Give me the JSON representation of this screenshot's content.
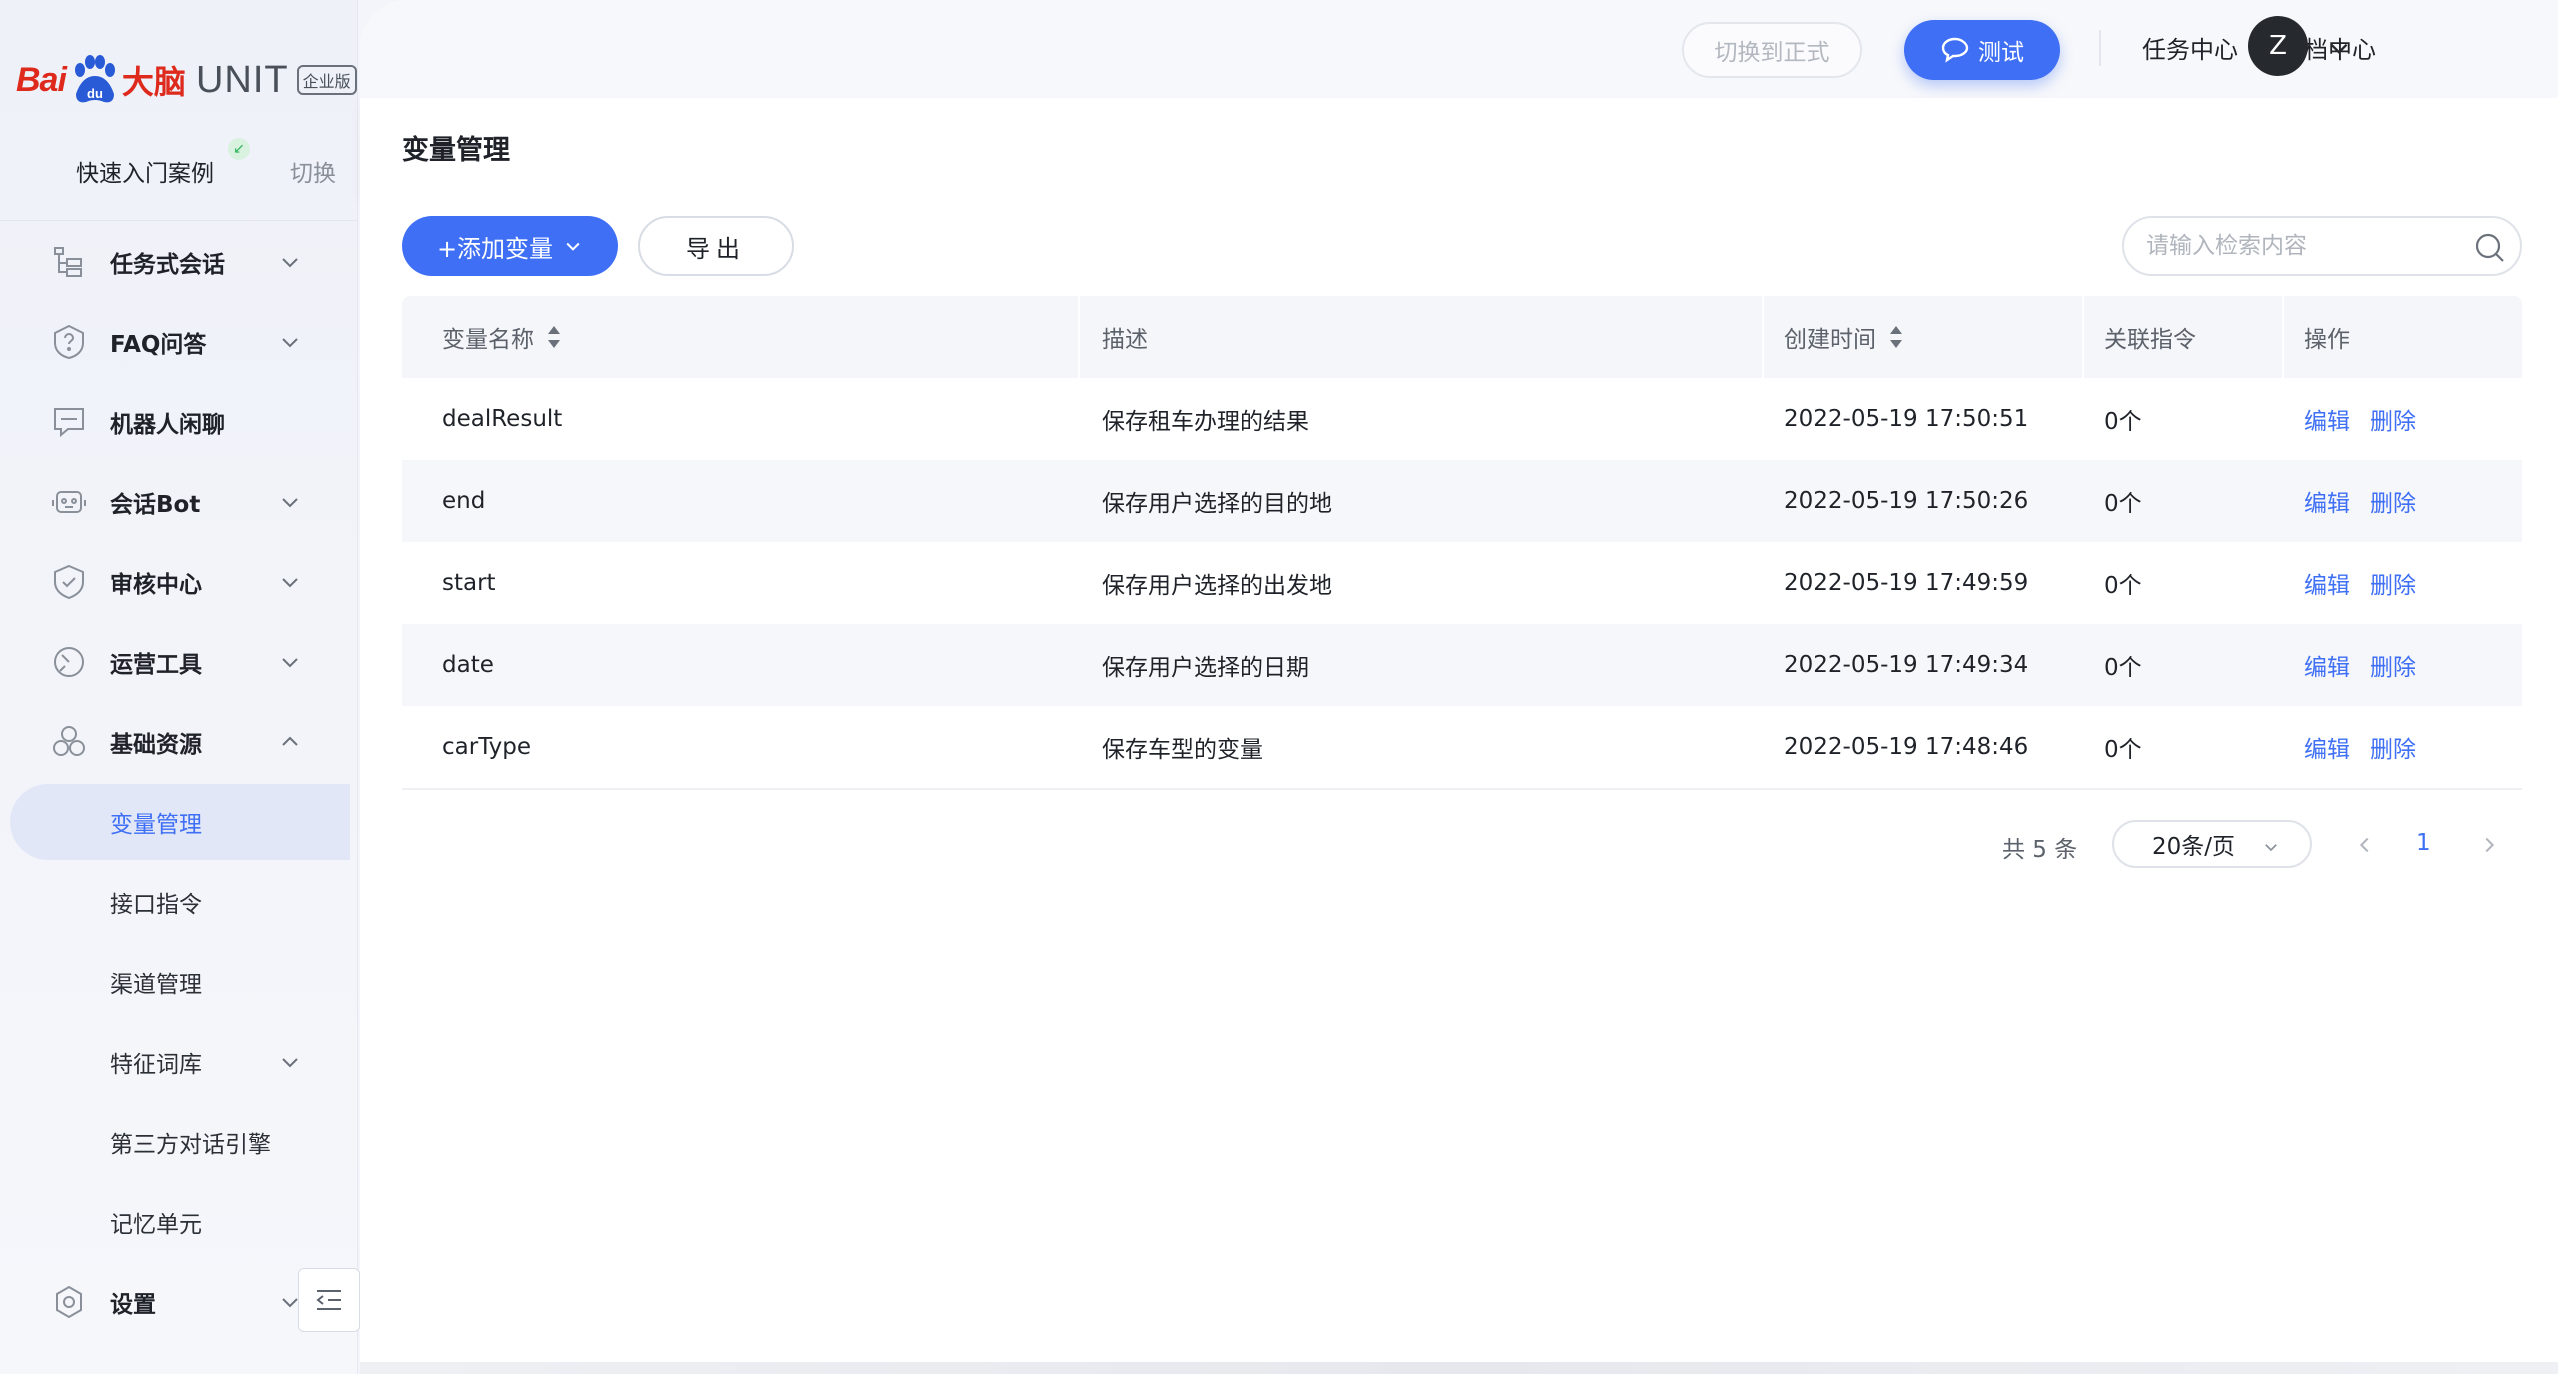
{
  "brand": {
    "logo_text_bai": "Bai",
    "logo_text_du": "du",
    "logo_text_brain": "大脑",
    "logo_text_unit": "UNIT",
    "edition_badge": "企业版"
  },
  "project": {
    "name": "快速入门案例",
    "switch_label": "切换"
  },
  "sidebar": {
    "items": [
      {
        "label": "任务式会话",
        "icon": "tree-icon",
        "expandable": true
      },
      {
        "label": "FAQ问答",
        "icon": "question-shield-icon",
        "expandable": true
      },
      {
        "label": "机器人闲聊",
        "icon": "chat-icon",
        "expandable": false
      },
      {
        "label": "会话Bot",
        "icon": "robot-icon",
        "expandable": true
      },
      {
        "label": "审核中心",
        "icon": "shield-check-icon",
        "expandable": true
      },
      {
        "label": "运营工具",
        "icon": "gauge-icon",
        "expandable": true
      },
      {
        "label": "基础资源",
        "icon": "cubes-icon",
        "expandable": true,
        "expanded": true
      }
    ],
    "sub_items": [
      {
        "label": "变量管理",
        "active": true
      },
      {
        "label": "接口指令"
      },
      {
        "label": "渠道管理"
      },
      {
        "label": "特征词库",
        "expandable": true
      },
      {
        "label": "第三方对话引擎"
      },
      {
        "label": "记忆单元"
      }
    ],
    "settings": {
      "label": "设置",
      "icon": "gear-icon"
    }
  },
  "topbar": {
    "switch_formal": "切换到正式",
    "test": "测试",
    "task_center": "任务中心",
    "doc_center": "文档中心",
    "avatar_initial": "Z"
  },
  "page": {
    "title": "变量管理"
  },
  "toolbar": {
    "add_label": "+添加变量",
    "export_label": "导出",
    "search_placeholder": "请输入检索内容"
  },
  "table": {
    "headers": [
      "变量名称",
      "描述",
      "创建时间",
      "关联指令",
      "操作"
    ],
    "rows": [
      {
        "name": "dealResult",
        "desc": "保存租车办理的结果",
        "time": "2022-05-19 17:50:51",
        "count": "0个"
      },
      {
        "name": "end",
        "desc": "保存用户选择的目的地",
        "time": "2022-05-19 17:50:26",
        "count": "0个"
      },
      {
        "name": "start",
        "desc": "保存用户选择的出发地",
        "time": "2022-05-19 17:49:59",
        "count": "0个"
      },
      {
        "name": "date",
        "desc": "保存用户选择的日期",
        "time": "2022-05-19 17:49:34",
        "count": "0个"
      },
      {
        "name": "carType",
        "desc": "保存车型的变量",
        "time": "2022-05-19 17:48:46",
        "count": "0个"
      }
    ],
    "action_edit": "编辑",
    "action_delete": "删除"
  },
  "pagination": {
    "total": "共 5 条",
    "page_size": "20条/页",
    "current_page": "1"
  },
  "colors": {
    "accent": "#3e6ff5",
    "brand_red": "#de2a1c"
  }
}
